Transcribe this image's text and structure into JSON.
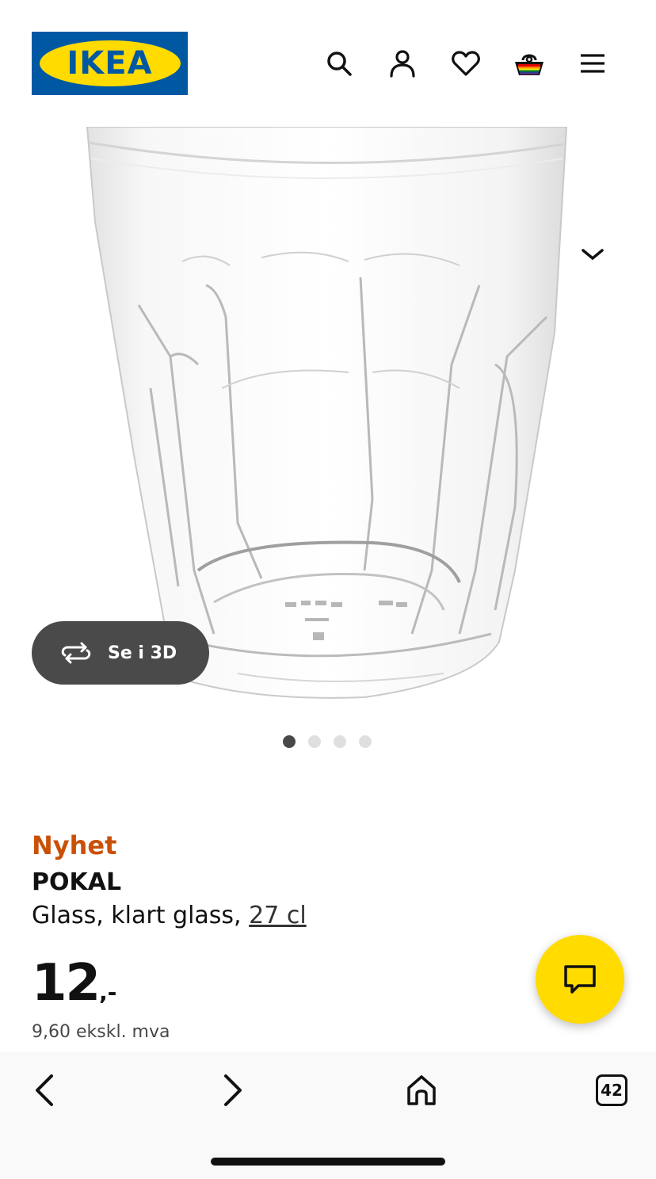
{
  "header": {
    "logo_text": "IKEA",
    "icons": [
      "search-icon",
      "user-icon",
      "heart-icon",
      "basket-icon",
      "menu-icon"
    ]
  },
  "gallery": {
    "image_alt": "POKAL glass",
    "view3d_label": "Se i 3D",
    "dots_total": 4,
    "dots_active": 1
  },
  "product": {
    "badge": "Nyhet",
    "name": "POKAL",
    "desc_prefix": "Glass, klart glass, ",
    "desc_size": "27 cl",
    "price_int": "12",
    "price_suffix": ",-",
    "price_ex_vat": "9,60 ekskl. mva"
  },
  "colors": {
    "ikea_blue": "#0058a3",
    "ikea_yellow": "#ffdb00",
    "badge_orange": "#ca5008"
  },
  "browser": {
    "tabs_count": "42"
  }
}
